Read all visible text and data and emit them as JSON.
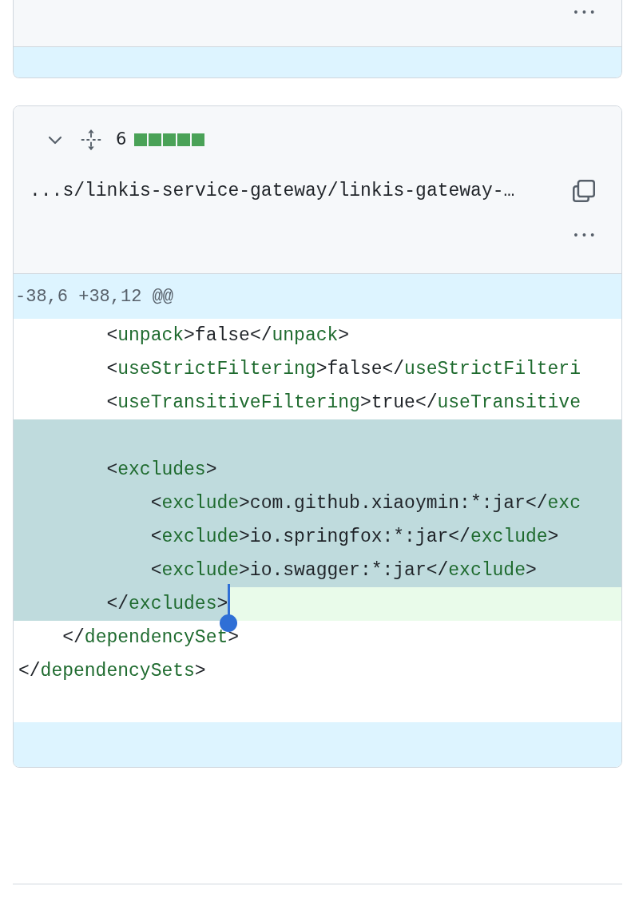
{
  "previous_file": {
    "more": "•••"
  },
  "file": {
    "expanded": true,
    "changes": "6",
    "diffstat": [
      {
        "kind": "added"
      },
      {
        "kind": "added"
      },
      {
        "kind": "added"
      },
      {
        "kind": "added"
      },
      {
        "kind": "added"
      }
    ],
    "path": "...s/linkis-service-gateway/linkis-gateway-…",
    "more": "•••",
    "hunk_header": "-38,6 +38,12 @@",
    "lines": [
      {
        "added": false,
        "selected": false,
        "segments": [
          {
            "kind": "text",
            "text": "        <"
          },
          {
            "kind": "tag",
            "text": "unpack"
          },
          {
            "kind": "text",
            "text": ">false</"
          },
          {
            "kind": "tag",
            "text": "unpack"
          },
          {
            "kind": "text",
            "text": ">"
          }
        ]
      },
      {
        "added": false,
        "selected": false,
        "segments": [
          {
            "kind": "text",
            "text": "        <"
          },
          {
            "kind": "tag",
            "text": "useStrictFiltering"
          },
          {
            "kind": "text",
            "text": ">false</"
          },
          {
            "kind": "tag",
            "text": "useStrictFilteri"
          }
        ]
      },
      {
        "added": false,
        "selected": false,
        "segments": [
          {
            "kind": "text",
            "text": "        <"
          },
          {
            "kind": "tag",
            "text": "useTransitiveFiltering"
          },
          {
            "kind": "text",
            "text": ">true</"
          },
          {
            "kind": "tag",
            "text": "useTransitive"
          }
        ]
      },
      {
        "added": true,
        "selected": true
      },
      {
        "added": true,
        "selected": true,
        "segments": [
          {
            "kind": "text",
            "text": "        <"
          },
          {
            "kind": "tag",
            "text": "excludes"
          },
          {
            "kind": "text",
            "text": ">"
          }
        ]
      },
      {
        "added": true,
        "selected": true,
        "segments": [
          {
            "kind": "text",
            "text": "            <"
          },
          {
            "kind": "tag",
            "text": "exclude"
          },
          {
            "kind": "text",
            "text": ">com.github.xiaoymin:*:jar</"
          },
          {
            "kind": "tag",
            "text": "exc"
          }
        ]
      },
      {
        "added": true,
        "selected": true,
        "segments": [
          {
            "kind": "text",
            "text": "            <"
          },
          {
            "kind": "tag",
            "text": "exclude"
          },
          {
            "kind": "text",
            "text": ">io.springfox:*:jar</"
          },
          {
            "kind": "tag",
            "text": "exclude"
          },
          {
            "kind": "text",
            "text": ">"
          }
        ]
      },
      {
        "added": true,
        "selected": true,
        "segments": [
          {
            "kind": "text",
            "text": "            <"
          },
          {
            "kind": "tag",
            "text": "exclude"
          },
          {
            "kind": "text",
            "text": ">io.swagger:*:jar</"
          },
          {
            "kind": "tag",
            "text": "exclude"
          },
          {
            "kind": "text",
            "text": ">"
          }
        ]
      },
      {
        "added": true,
        "selected": true,
        "selection_end": true,
        "segments": [
          {
            "kind": "text",
            "text": "        </"
          },
          {
            "kind": "tag",
            "text": "excludes"
          },
          {
            "kind": "text",
            "text": ">"
          }
        ]
      },
      {
        "added": false,
        "selected": false,
        "segments": [
          {
            "kind": "text",
            "text": "    </"
          },
          {
            "kind": "tag",
            "text": "dependencySet"
          },
          {
            "kind": "text",
            "text": ">"
          }
        ]
      },
      {
        "added": false,
        "selected": false,
        "segments": [
          {
            "kind": "text",
            "text": "</"
          },
          {
            "kind": "tag",
            "text": "dependencySets"
          },
          {
            "kind": "text",
            "text": ">"
          }
        ]
      }
    ]
  }
}
